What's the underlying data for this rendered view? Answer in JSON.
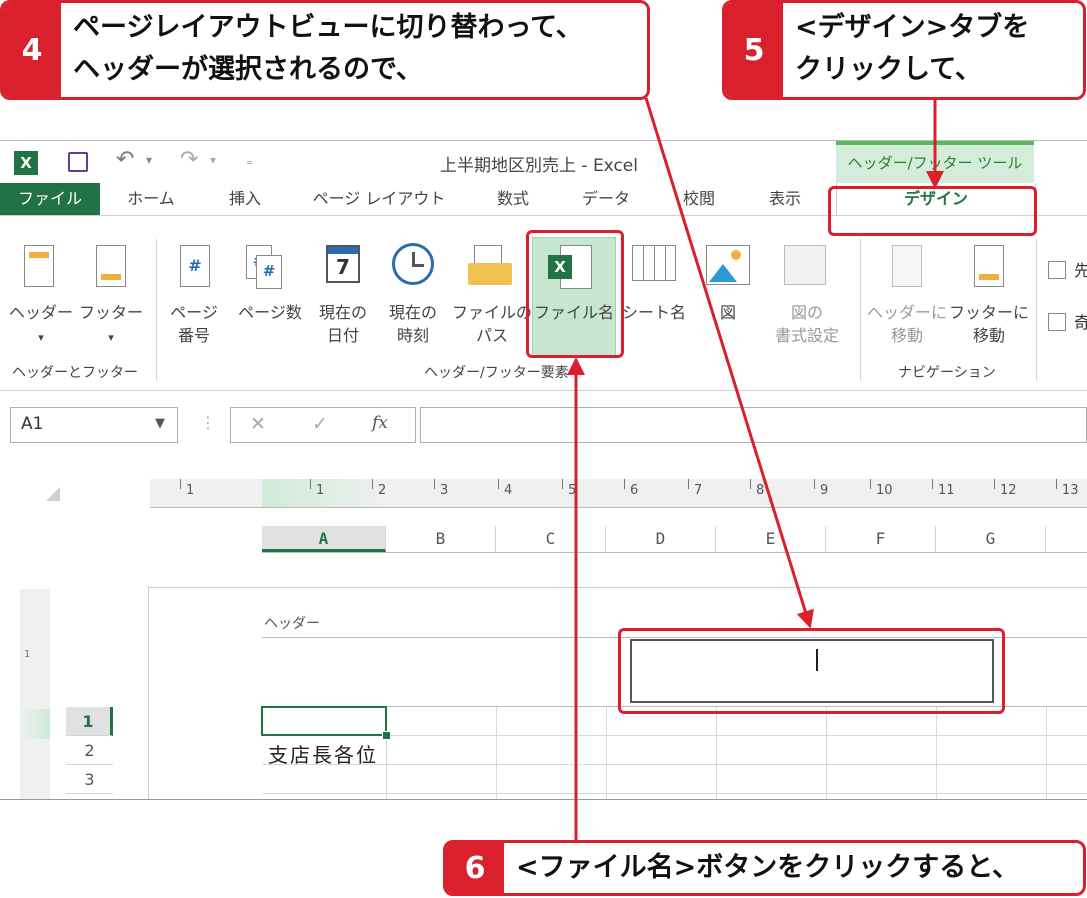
{
  "callouts": {
    "c4": {
      "num": "4",
      "line1": "ページレイアウトビューに切り替わって、",
      "line2": "ヘッダーが選択されるので、"
    },
    "c5": {
      "num": "5",
      "line1": "<デザイン>タブを",
      "line2": "クリックして、"
    },
    "c6": {
      "num": "6",
      "line1": "<ファイル名>ボタンをクリックすると、"
    }
  },
  "window": {
    "title": "上半期地区別売上 - Excel",
    "context_tab": "ヘッダー/フッター ツール"
  },
  "tabs": [
    {
      "label": "ファイル"
    },
    {
      "label": "ホーム"
    },
    {
      "label": "挿入"
    },
    {
      "label": "ページ レイアウト"
    },
    {
      "label": "数式"
    },
    {
      "label": "データ"
    },
    {
      "label": "校閲"
    },
    {
      "label": "表示"
    },
    {
      "label": "デザイン"
    }
  ],
  "ribbon": {
    "header": {
      "l1": "ヘッダー",
      "l2": "▾"
    },
    "footer": {
      "l1": "フッター",
      "l2": "▾"
    },
    "page_number": {
      "l1": "ページ",
      "l2": "番号"
    },
    "page_count": {
      "l1": "ページ数"
    },
    "current_date": {
      "l1": "現在の",
      "l2": "日付"
    },
    "current_time": {
      "l1": "現在の",
      "l2": "時刻"
    },
    "file_path": {
      "l1": "ファイルの",
      "l2": "パス"
    },
    "file_name": {
      "l1": "ファイル名"
    },
    "sheet_name": {
      "l1": "シート名"
    },
    "picture": {
      "l1": "図"
    },
    "format_picture": {
      "l1": "図の",
      "l2": "書式設定"
    },
    "goto_header": {
      "l1": "ヘッダーに",
      "l2": "移動"
    },
    "goto_footer": {
      "l1": "フッターに",
      "l2": "移動"
    },
    "opt1": "先",
    "opt2": "奇",
    "groups": {
      "hf": "ヘッダーとフッター",
      "elements": "ヘッダー/フッター要素",
      "navigation": "ナビゲーション"
    }
  },
  "formula": {
    "name_box": "A1",
    "cancel": "✕",
    "enter": "✓",
    "fx": "fx"
  },
  "ruler": [
    "1",
    "1",
    "2",
    "3",
    "4",
    "5",
    "6",
    "7",
    "8",
    "9",
    "10",
    "11",
    "12",
    "13"
  ],
  "columns": [
    "A",
    "B",
    "C",
    "D",
    "E",
    "F",
    "G"
  ],
  "rows": [
    "1",
    "2",
    "3"
  ],
  "sheet": {
    "header_label": "ヘッダー",
    "a2": "支店長各位"
  },
  "colors": {
    "accent": "#d9202c",
    "excel_green": "#217346",
    "context_green": "#4caf50"
  }
}
